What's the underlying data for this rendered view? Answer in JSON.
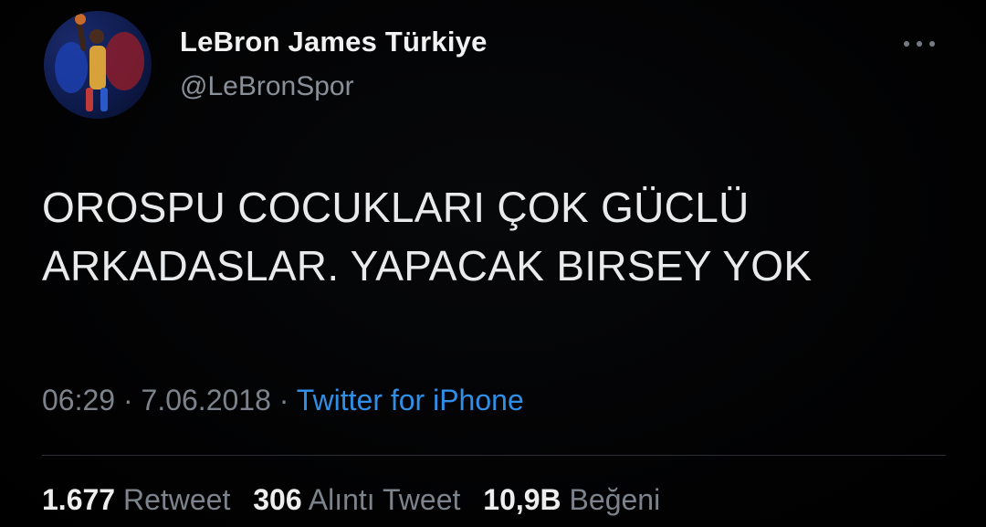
{
  "author": {
    "display_name": "LeBron James Türkiye",
    "handle": "@LeBronSpor",
    "avatar_icon": "basketball-player-avatar"
  },
  "menu": {
    "more_icon": "more-options-icon"
  },
  "tweet": {
    "line1": "OROSPU COCUKLARI ÇOK GÜCLÜ",
    "line2": "ARKADASLAR. YAPACAK BIRSEY YOK"
  },
  "meta": {
    "time": "06:29",
    "separator": "·",
    "date": "7.06.2018",
    "source": "Twitter for iPhone"
  },
  "stats": {
    "retweets_count": "1.677",
    "retweets_label": "Retweet",
    "quotes_count": "306",
    "quotes_label": "Alıntı Tweet",
    "likes_count": "10,9B",
    "likes_label": "Beğeni"
  },
  "colors": {
    "background": "#000000",
    "link": "#2f8fe6",
    "secondary_text": "#7d838c"
  }
}
